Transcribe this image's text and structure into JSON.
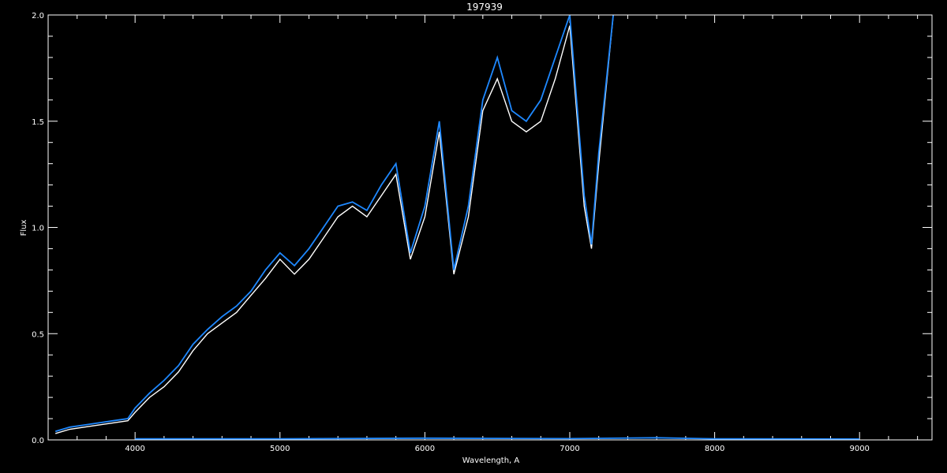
{
  "chart_data": {
    "type": "line",
    "title": "197939",
    "xlabel": "Wavelength, A",
    "ylabel": "Flux",
    "xlim": [
      3400,
      9500
    ],
    "ylim": [
      0.0,
      2.0
    ],
    "xticks": [
      4000,
      5000,
      6000,
      7000,
      8000,
      9000
    ],
    "xtick_labels": [
      "4000",
      "5000",
      "6000",
      "7000",
      "8000",
      "9000"
    ],
    "yticks": [
      0.0,
      0.5,
      1.0,
      1.5,
      2.0
    ],
    "ytick_labels": [
      "0.0",
      "0.5",
      "1.0",
      "1.5",
      "2.0"
    ],
    "background": "#000000",
    "axis_color": "#ffffff",
    "series": [
      {
        "color": "#ffffff",
        "x": [
          3450,
          3550,
          3650,
          3750,
          3850,
          3950,
          4000,
          4100,
          4200,
          4300,
          4400,
          4500,
          4600,
          4700,
          4800,
          4900,
          5000,
          5100,
          5200,
          5300,
          5400,
          5500,
          5600,
          5700,
          5800,
          5900,
          6000,
          6100,
          6200,
          6300,
          6400,
          6500,
          6600,
          6700,
          6800,
          6900,
          7000,
          7100,
          7150,
          7200,
          7300
        ],
        "y": [
          0.03,
          0.05,
          0.06,
          0.07,
          0.08,
          0.09,
          0.13,
          0.2,
          0.25,
          0.32,
          0.42,
          0.5,
          0.55,
          0.6,
          0.68,
          0.76,
          0.85,
          0.78,
          0.85,
          0.95,
          1.05,
          1.1,
          1.05,
          1.15,
          1.25,
          0.85,
          1.05,
          1.45,
          0.78,
          1.05,
          1.55,
          1.7,
          1.5,
          1.45,
          1.5,
          1.7,
          1.95,
          1.1,
          0.9,
          1.3,
          2.0
        ]
      },
      {
        "color": "#1e88ff",
        "x": [
          3450,
          3550,
          3650,
          3750,
          3850,
          3950,
          4000,
          4100,
          4200,
          4300,
          4400,
          4500,
          4600,
          4700,
          4800,
          4900,
          5000,
          5100,
          5200,
          5300,
          5400,
          5500,
          5600,
          5700,
          5800,
          5900,
          6000,
          6100,
          6200,
          6300,
          6400,
          6500,
          6600,
          6700,
          6800,
          6900,
          7000,
          7100,
          7150,
          7200,
          7300
        ],
        "y": [
          0.04,
          0.06,
          0.07,
          0.08,
          0.09,
          0.1,
          0.15,
          0.22,
          0.28,
          0.35,
          0.45,
          0.52,
          0.58,
          0.63,
          0.7,
          0.8,
          0.88,
          0.82,
          0.9,
          1.0,
          1.1,
          1.12,
          1.08,
          1.2,
          1.3,
          0.88,
          1.1,
          1.5,
          0.8,
          1.1,
          1.6,
          1.8,
          1.55,
          1.5,
          1.6,
          1.8,
          2.0,
          1.15,
          0.92,
          1.35,
          2.0
        ]
      },
      {
        "color": "#1e88ff",
        "x": [
          4000,
          5000,
          6000,
          7000,
          7600,
          8000,
          9000
        ],
        "y": [
          0.005,
          0.005,
          0.008,
          0.006,
          0.01,
          0.005,
          0.004
        ]
      }
    ]
  }
}
